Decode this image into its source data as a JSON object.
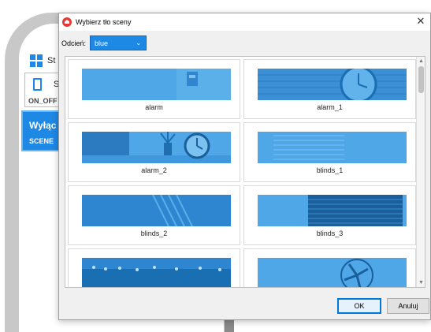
{
  "background_app": {
    "row1_text": "St",
    "card1_text": "S",
    "card1_tag": "ON_OFF",
    "card2_title": "Wyłąc",
    "card2_tag": "SCENE"
  },
  "dialog": {
    "title": "Wybierz tło sceny",
    "close_glyph": "✕",
    "shade_label": "Odcień:",
    "shade_value": "blue",
    "ok_label": "OK",
    "cancel_label": "Anuluj"
  },
  "tiles": [
    {
      "name": "alarm",
      "icon": "alarm-thumbnail"
    },
    {
      "name": "alarm_1",
      "icon": "alarm-clock-thumbnail"
    },
    {
      "name": "alarm_2",
      "icon": "alarm-clock-plant-thumbnail"
    },
    {
      "name": "blinds_1",
      "icon": "blinds-thumbnail"
    },
    {
      "name": "blinds_2",
      "icon": "blinds-thumbnail"
    },
    {
      "name": "blinds_3",
      "icon": "blinds-thumbnail"
    },
    {
      "name": "",
      "icon": "city-lights-thumbnail"
    },
    {
      "name": "",
      "icon": "fan-thumbnail"
    }
  ],
  "colors": {
    "accent": "#1e88e5",
    "thumb_light": "#4fa7e8",
    "thumb_dark": "#1a6fb3"
  }
}
